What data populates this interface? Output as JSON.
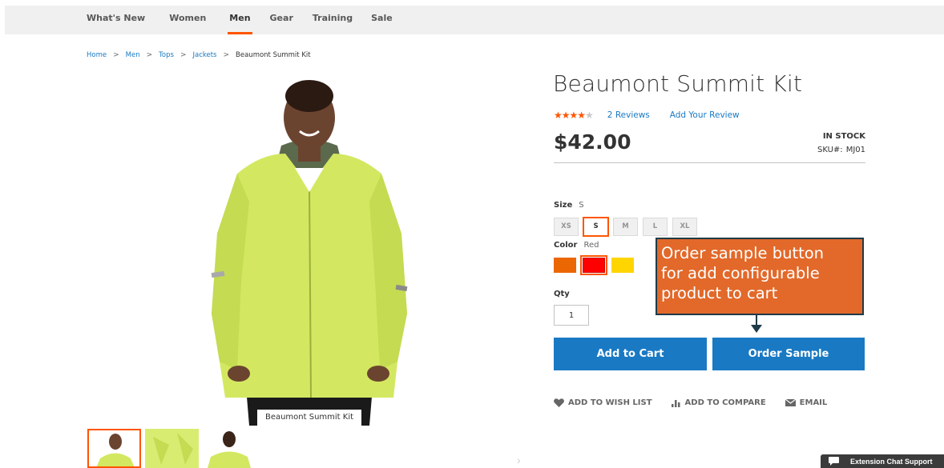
{
  "nav": {
    "items": [
      {
        "label": "What's New"
      },
      {
        "label": "Women"
      },
      {
        "label": "Men"
      },
      {
        "label": "Gear"
      },
      {
        "label": "Training"
      },
      {
        "label": "Sale"
      }
    ],
    "active": "Men",
    "accent_color": "#ff5501"
  },
  "breadcrumb": {
    "links": [
      "Home",
      "Men",
      "Tops",
      "Jackets"
    ],
    "current": "Beaumont Summit Kit",
    "separator": ">"
  },
  "gallery": {
    "caption": "Beaumont Summit Kit",
    "thumb_count": 3,
    "active_thumb": 0,
    "next_arrow": "›"
  },
  "product": {
    "title": "Beaumont Summit Kit",
    "rating": 4.5,
    "reviews_label": "2  Reviews",
    "add_review_label": "Add Your Review",
    "price": "$42.00",
    "stock": "IN STOCK",
    "sku_label": "SKU#:",
    "sku": "MJ01"
  },
  "options": {
    "size_label": "Size",
    "size_value": "S",
    "sizes": [
      "XS",
      "S",
      "M",
      "L",
      "XL"
    ],
    "color_label": "Color",
    "color_value": "Red",
    "colors": [
      {
        "name": "orange",
        "hex": "#eb6703"
      },
      {
        "name": "red",
        "hex": "#ff0000"
      },
      {
        "name": "yellow",
        "hex": "#ffd500"
      }
    ],
    "qty_label": "Qty",
    "qty": "1"
  },
  "buttons": {
    "add_to_cart": "Add to Cart",
    "order_sample": "Order Sample",
    "color": "#1979c3"
  },
  "callout": {
    "text": "Order sample button for add configurable product to cart",
    "line1": "Order sample button",
    "line2": "for add configurable",
    "line3": "product to cart",
    "bg": "#e2692a"
  },
  "actions": {
    "wishlist": "ADD TO WISH LIST",
    "compare": "ADD TO COMPARE",
    "email": "EMAIL"
  },
  "chat": {
    "label": "Extension Chat Support"
  }
}
